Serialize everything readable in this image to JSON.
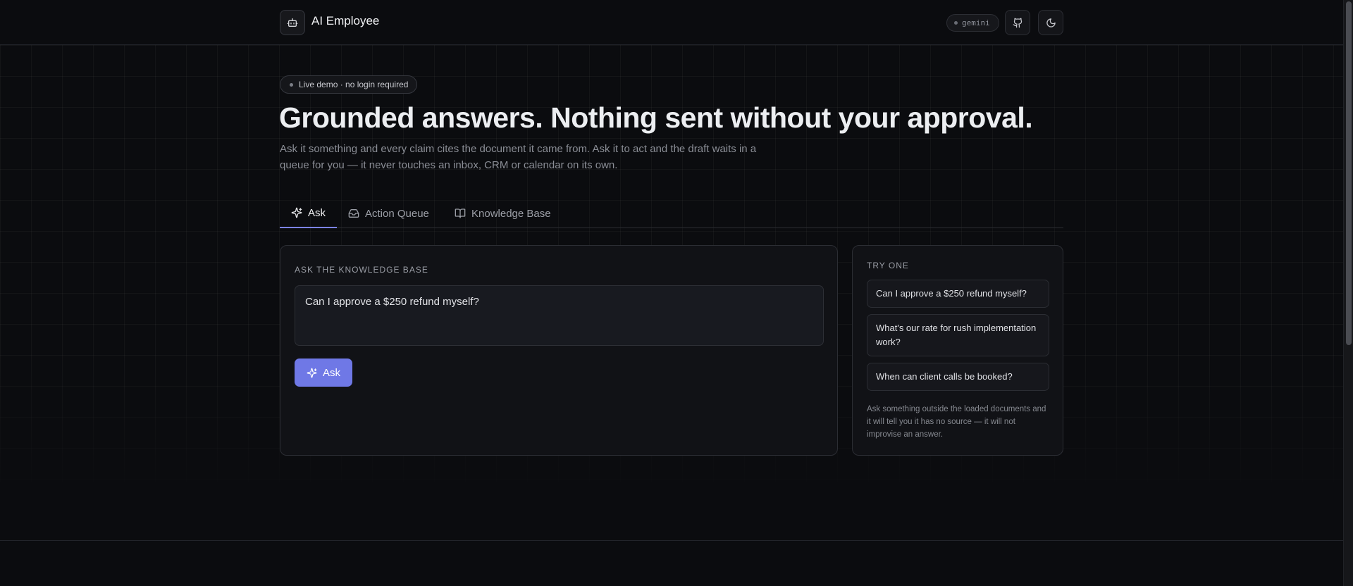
{
  "header": {
    "app_title": "AI Employee",
    "model_label": "gemini",
    "logo_icon": "robot-icon",
    "github_icon": "github-icon",
    "theme_icon": "moon-icon"
  },
  "hero": {
    "badge": "Live demo · no login required",
    "title": "Grounded answers. Nothing sent without your approval.",
    "subtitle": "Ask it something and every claim cites the document it came from. Ask it to act and the draft waits in a queue for you — it never touches an inbox, CRM or calendar on its own."
  },
  "tabs": [
    {
      "label": "Ask",
      "icon": "sparkles-icon",
      "active": true
    },
    {
      "label": "Action Queue",
      "icon": "inbox-icon",
      "active": false
    },
    {
      "label": "Knowledge Base",
      "icon": "book-icon",
      "active": false
    }
  ],
  "ask": {
    "label": "ASK THE KNOWLEDGE BASE",
    "input_value": "Can I approve a $250 refund myself?",
    "button_label": "Ask"
  },
  "try_one": {
    "label": "TRY ONE",
    "suggestions": [
      "Can I approve a $250 refund myself?",
      "What's our rate for rush implementation work?",
      "When can client calls be booked?"
    ],
    "note": "Ask something outside the loaded documents and it will tell you it has no source — it will not improvise an answer."
  },
  "colors": {
    "accent": "#6f78e6",
    "background": "#0b0c0f",
    "card": "#111216"
  }
}
